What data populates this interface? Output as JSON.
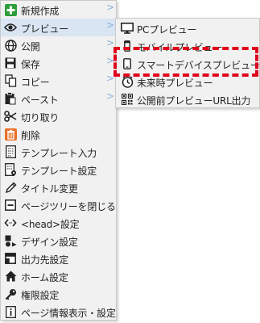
{
  "menu": {
    "items": [
      {
        "label": "新規作成",
        "icon": "plus-square-icon",
        "has_submenu": true
      },
      {
        "label": "プレビュー",
        "icon": "eye-icon",
        "has_submenu": true
      },
      {
        "label": "公開",
        "icon": "globe-icon",
        "has_submenu": true
      },
      {
        "label": "保存",
        "icon": "floppy-disk-icon",
        "has_submenu": true
      },
      {
        "label": "コピー",
        "icon": "copy-icon",
        "has_submenu": true
      },
      {
        "label": "ペースト",
        "icon": "clipboard-icon",
        "has_submenu": true
      },
      {
        "label": "切り取り",
        "icon": "scissors-icon",
        "has_submenu": false
      },
      {
        "label": "削除",
        "icon": "trash-icon",
        "has_submenu": false
      },
      {
        "label": "テンプレート入力",
        "icon": "template-input-icon",
        "has_submenu": false
      },
      {
        "label": "テンプレート設定",
        "icon": "template-settings-icon",
        "has_submenu": false
      },
      {
        "label": "タイトル変更",
        "icon": "pencil-icon",
        "has_submenu": false
      },
      {
        "label": "ページツリーを閉じる",
        "icon": "collapse-square-icon",
        "has_submenu": false
      },
      {
        "label": "<head>設定",
        "icon": "code-brackets-icon",
        "has_submenu": false
      },
      {
        "label": "デザイン設定",
        "icon": "shapes-icon",
        "has_submenu": false
      },
      {
        "label": "出力先設定",
        "icon": "output-layout-icon",
        "has_submenu": false
      },
      {
        "label": "ホーム設定",
        "icon": "home-icon",
        "has_submenu": false
      },
      {
        "label": "権限設定",
        "icon": "key-icon",
        "has_submenu": false
      },
      {
        "label": "ページ情報表示・設定",
        "icon": "info-icon",
        "has_submenu": false
      }
    ],
    "arrow_glyph": ">",
    "active_item": "プレビュー"
  },
  "submenu": {
    "items": [
      {
        "label": "PCプレビュー",
        "icon": "monitor-icon"
      },
      {
        "label": "モバイルプレビュー",
        "icon": "mobile-phone-icon"
      },
      {
        "label": "スマートデバイスプレビュー",
        "icon": "smart-device-icon"
      },
      {
        "label": "未来時プレビュー",
        "icon": "future-clock-icon"
      },
      {
        "label": "公開前プレビューURL出力",
        "icon": "qr-code-icon"
      }
    ],
    "highlighted_item": "スマートデバイスプレビュー"
  },
  "colors": {
    "menu_bg": "#f1f1f1",
    "active_bg": "#d9e5f3",
    "arrow": "#8ab0d8",
    "highlight_border": "#e0001a",
    "new_icon_green": "#2e9d3b",
    "delete_icon_orange": "#e8702a"
  }
}
